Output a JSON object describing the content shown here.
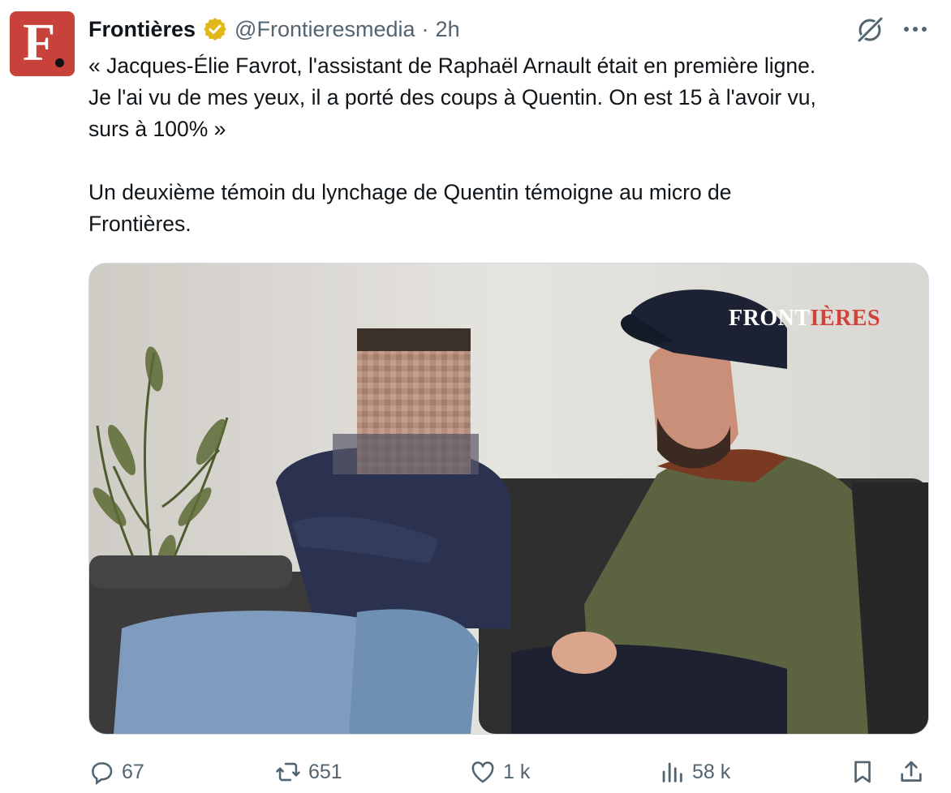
{
  "author": {
    "name": "Frontières",
    "handle": "@Frontieresmedia",
    "separator": "·",
    "time": "2h",
    "avatar_letter": "F."
  },
  "icons": {
    "verified": "verified-badge-icon",
    "grok": "grok-icon",
    "more": "more-options-icon",
    "reply": "reply-icon",
    "retweet": "retweet-icon",
    "like": "like-icon",
    "views": "views-icon",
    "bookmark": "bookmark-icon",
    "share": "share-icon"
  },
  "tweet": {
    "line1": "« Jacques-Élie Favrot, l'assistant de Raphaël Arnault était en première ligne.",
    "line2": "Je l'ai vu de mes yeux, il a porté des coups à Quentin. On est 15 à l'avoir vu,",
    "line3": "surs à 100% »",
    "line4": "Un deuxième témoin du lynchage de Quentin témoigne au micro de",
    "line5": "Frontières."
  },
  "media": {
    "watermark_part1": "FRONT",
    "watermark_part2": "IÈRES"
  },
  "actions": {
    "replies": "67",
    "retweets": "651",
    "likes": "1 k",
    "views": "58 k"
  },
  "colors": {
    "verified_gold": "#e2b719",
    "secondary_text": "#536471",
    "brand_red": "#c8413a"
  }
}
